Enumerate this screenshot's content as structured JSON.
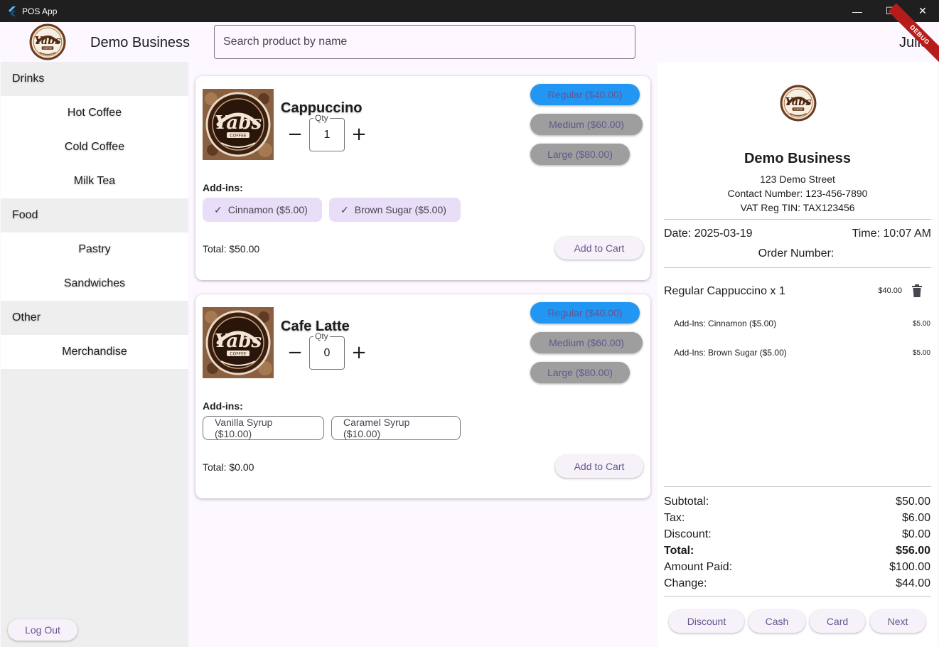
{
  "window": {
    "title": "POS App",
    "minimize": "—",
    "maximize": "☐",
    "close": "✕"
  },
  "header": {
    "business_name": "Demo Business",
    "search_placeholder": "Search product by name",
    "user_name": "Julie",
    "debug_label": "DEBUG"
  },
  "sidebar": {
    "categories": [
      {
        "header": "Drinks",
        "items": [
          "Hot Coffee",
          "Cold Coffee",
          "Milk Tea"
        ]
      },
      {
        "header": "Food",
        "items": [
          "Pastry",
          "Sandwiches"
        ]
      },
      {
        "header": "Other",
        "items": [
          "Merchandise"
        ]
      }
    ],
    "logout_label": "Log Out"
  },
  "products": [
    {
      "name": "Cappuccino",
      "qty_label": "Qty",
      "qty": "1",
      "sizes": [
        "Regular ($40.00)",
        "Medium ($60.00)",
        "Large ($80.00)"
      ],
      "selected_size": "Regular ($40.00)",
      "addins_label": "Add-ins:",
      "addins": [
        {
          "label": "Cinnamon ($5.00)",
          "selected": true
        },
        {
          "label": "Brown Sugar ($5.00)",
          "selected": true
        }
      ],
      "total": "Total: $50.00",
      "add_to_cart": "Add to Cart"
    },
    {
      "name": "Cafe Latte",
      "qty_label": "Qty",
      "qty": "0",
      "sizes": [
        "Regular ($40.00)",
        "Medium ($60.00)",
        "Large ($80.00)"
      ],
      "selected_size": "Regular ($40.00)",
      "addins_label": "Add-ins:",
      "addins": [
        {
          "label": "Vanilla Syrup ($10.00)",
          "selected": false
        },
        {
          "label": "Caramel Syrup ($10.00)",
          "selected": false
        }
      ],
      "total": "Total: $0.00",
      "add_to_cart": "Add to Cart"
    }
  ],
  "receipt": {
    "business_name": "Demo Business",
    "address": "123 Demo Street",
    "contact": "Contact Number: 123-456-7890",
    "vat": "VAT Reg TIN: TAX123456",
    "date": "Date: 2025-03-19",
    "time": "Time: 10:07 AM",
    "order_number": "Order Number:",
    "items": [
      {
        "name": "Regular Cappuccino x 1",
        "price": "$40.00",
        "addins": [
          {
            "name": "Add-Ins: Cinnamon ($5.00)",
            "price": "$5.00"
          },
          {
            "name": "Add-Ins: Brown Sugar ($5.00)",
            "price": "$5.00"
          }
        ]
      }
    ],
    "summary": {
      "subtotal_label": "Subtotal:",
      "subtotal": "$50.00",
      "tax_label": "Tax:",
      "tax": "$6.00",
      "discount_label": "Discount:",
      "discount": "$0.00",
      "total_label": "Total:",
      "total": "$56.00",
      "paid_label": "Amount Paid:",
      "paid": "$100.00",
      "change_label": "Change:",
      "change": "$44.00"
    },
    "actions": [
      "Discount",
      "Cash",
      "Card",
      "Next"
    ]
  },
  "colors": {
    "selected_size": "#2196f3",
    "unselected_size": "#9e9e9e",
    "accent_text": "#65558f",
    "chip_selected": "#e8def8"
  },
  "icons": {
    "app": "flutter-icon",
    "logo": "yabs-coffee-logo",
    "trash": "trash-icon",
    "check": "check-icon"
  }
}
